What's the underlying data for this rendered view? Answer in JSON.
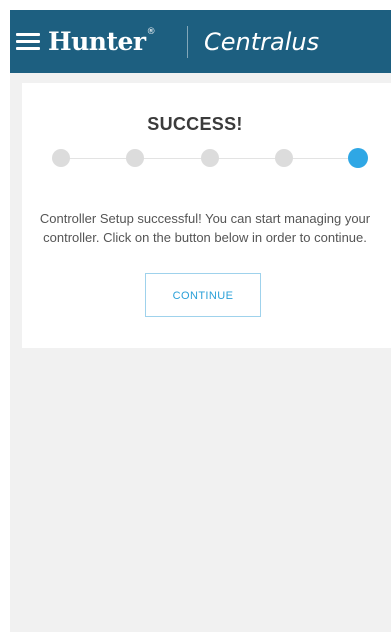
{
  "header": {
    "menu_icon": "hamburger-menu-icon",
    "brand_name": "Hunter",
    "brand_mark": "®",
    "product_name": "Centralus",
    "background_color": "#1d5f80"
  },
  "setup_status": {
    "title": "SUCCESS!",
    "message": "Controller Setup successful! You can start managing your controller. Click on the button below in order to continue.",
    "steps_total": 5,
    "current_step": 5,
    "active_step_color": "#2fa7e5",
    "inactive_step_color": "#dcdcdc",
    "continue_label": "CONTINUE"
  }
}
